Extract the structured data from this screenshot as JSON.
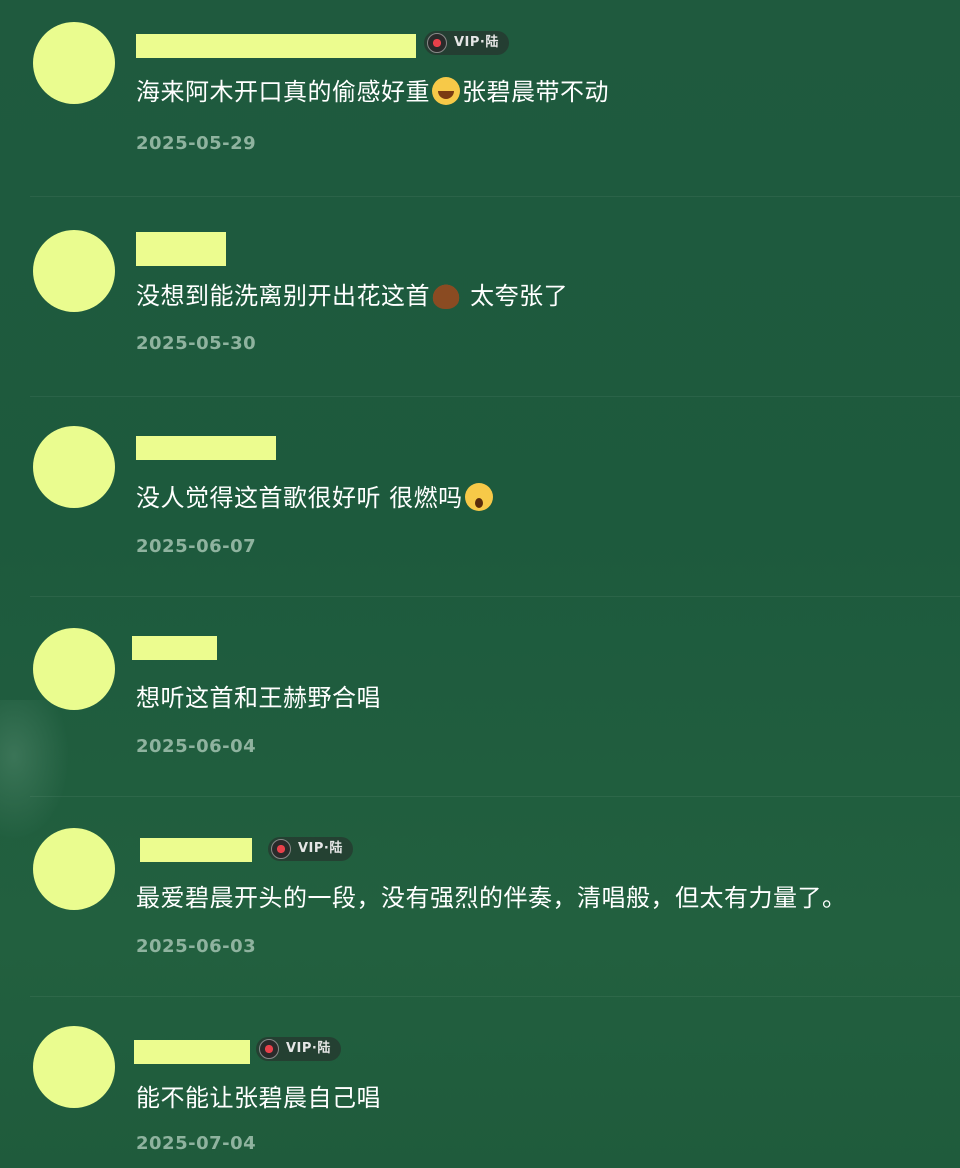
{
  "vip_badge_label": "VIP·陆",
  "comments": [
    {
      "text_before": "海来阿木开口真的偷感好重",
      "emoji": "laughing-crying-emoji",
      "text_after": "张碧晨带不动",
      "date": "2025-05-29",
      "vip": true
    },
    {
      "text_before": "没想到能洗离别开出花这首",
      "emoji": "poop-emoji",
      "text_after": " 太夸张了",
      "date": "2025-05-30",
      "vip": false
    },
    {
      "text_before": "没人觉得这首歌很好听 很燃吗",
      "emoji": "screaming-face-emoji",
      "text_after": "",
      "date": "2025-06-07",
      "vip": false
    },
    {
      "text_before": "想听这首和王赫野合唱",
      "emoji": "",
      "text_after": "",
      "date": "2025-06-04",
      "vip": false
    },
    {
      "text_before": "最爱碧晨开头的一段，没有强烈的伴奏，清唱般，但太有力量了。",
      "emoji": "",
      "text_after": "",
      "date": "2025-06-03",
      "vip": true
    },
    {
      "text_before": "能不能让张碧晨自己唱",
      "emoji": "",
      "text_after": "",
      "date": "2025-07-04",
      "vip": true
    }
  ]
}
